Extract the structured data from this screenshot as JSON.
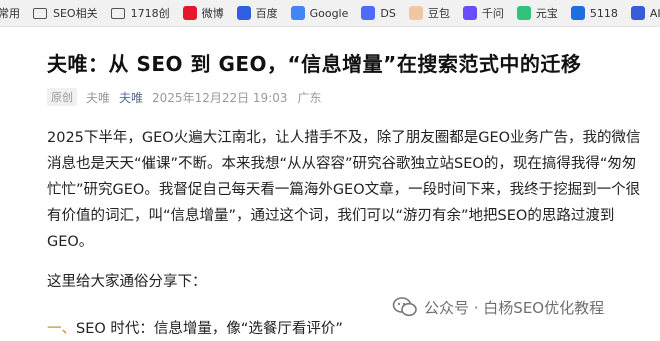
{
  "bookmarks": [
    {
      "label": "常用",
      "type": "text"
    },
    {
      "label": "SEO相关",
      "type": "folder"
    },
    {
      "label": "1718创",
      "type": "folder"
    },
    {
      "label": "微博",
      "type": "icon",
      "icon": "weibo-icon",
      "color": "#e6162d"
    },
    {
      "label": "百度",
      "type": "icon",
      "icon": "baidu-icon",
      "color": "#2f5fe0"
    },
    {
      "label": "Google",
      "type": "icon",
      "icon": "google-icon",
      "color": "#4285f4"
    },
    {
      "label": "DS",
      "type": "icon",
      "icon": "deepseek-icon",
      "color": "#4d6bfe"
    },
    {
      "label": "豆包",
      "type": "icon",
      "icon": "doubao-icon",
      "color": "#f2c6a0"
    },
    {
      "label": "千问",
      "type": "icon",
      "icon": "qianwen-icon",
      "color": "#6a4cff"
    },
    {
      "label": "元宝",
      "type": "icon",
      "icon": "yuanbao-icon",
      "color": "#31c27c"
    },
    {
      "label": "5118",
      "type": "icon",
      "icon": "5118-icon",
      "color": "#1d6fe0"
    },
    {
      "label": "AIDS",
      "type": "icon",
      "icon": "aids-icon",
      "color": "#3a5bd9"
    }
  ],
  "article": {
    "title": "夫唯：从 SEO 到 GEO，“信息增量”在搜索范式中的迁移",
    "badge": "原创",
    "author": "夫唯",
    "account": "夫唯",
    "date": "2025年12月22日 19:03",
    "location": "广东",
    "paragraph1": "2025下半年，GEO火遍大江南北，让人措手不及，除了朋友圈都是GEO业务广告，我的微信消息也是天天“催课”不断。本来我想“从从容容”研究谷歌独立站SEO的，现在搞得我得“匆匆忙忙”研究GEO。我督促自己每天看一篇海外GEO文章，一段时间下来，我终于挖掘到一个很有价值的词汇，叫“信息增量”，通过这个词，我们可以“游刃有余”地把SEO的思路过渡到GEO。",
    "paragraph2": "这里给大家通俗分享下：",
    "section_number": "一、",
    "section_text": "SEO 时代：信息增量，像“选餐厅看评价”"
  },
  "watermark": "公众号 · 白杨SEO优化教程",
  "colors": {
    "accent": "#576b95",
    "section_number": "#d08a2b"
  }
}
